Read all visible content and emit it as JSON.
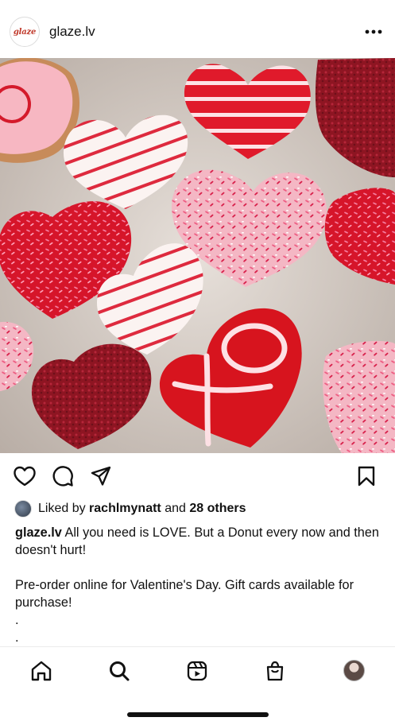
{
  "header": {
    "username": "glaze.lv",
    "avatar_logo_text": "glaze",
    "more_icon": "more-horizontal-icon"
  },
  "post": {
    "image_alt": "Heart-shaped glazed donuts with sprinkles and drizzle",
    "colors": {
      "red_glaze": "#d7141e",
      "pink_glaze": "#f3a9b8",
      "white_glaze": "#f6f0ef",
      "sprinkle_pink": "#f06a8d"
    }
  },
  "actions": {
    "like_icon": "heart-icon",
    "comment_icon": "comment-icon",
    "share_icon": "send-icon",
    "save_icon": "bookmark-icon"
  },
  "likes": {
    "prefix": "Liked by",
    "user": "rachlmynatt",
    "connector": "and",
    "others": "28 others"
  },
  "caption": {
    "username": "glaze.lv",
    "line1": "All you need is LOVE. But a Donut every now and then doesn't hurt!",
    "line2": "Pre-order online for Valentine's Day. Gift cards available for purchase!",
    "dot1": ".",
    "dot2": "."
  },
  "tabbar": {
    "home_icon": "home-icon",
    "search_icon": "search-icon",
    "reels_icon": "reels-icon",
    "shop_icon": "shop-bag-icon",
    "profile": "profile-avatar"
  }
}
